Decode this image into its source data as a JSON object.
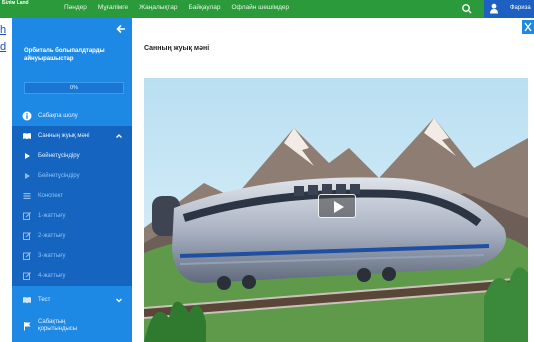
{
  "header": {
    "logo_text": "Білім Land",
    "nav": [
      "Пәндер",
      "Мұғалімге",
      "Жаңалықтар",
      "Байқаулар",
      "Офлайн шешімдер"
    ],
    "user_name": "Фариза",
    "icons": {
      "search": "search-icon",
      "user": "user-icon"
    },
    "colors": {
      "bar": "#2b9a3a",
      "user_block": "#1e5fc2"
    }
  },
  "left_fragment": {
    "line1": "h",
    "line2": "d"
  },
  "sidebar": {
    "course_title": "Орбиталь болыпалдтарды айнуырашыстар",
    "progress_text": "0%",
    "progress": 0,
    "items": [
      {
        "label": "Сабақпа шолу",
        "icon": "info-icon"
      },
      {
        "label": "Санның жуық мәні",
        "icon": "book-icon",
        "expanded": true
      },
      {
        "label": "Бейнетұсіндіру",
        "icon": "play-icon"
      },
      {
        "label": "Бейнетұсіндіру",
        "icon": "play-icon"
      },
      {
        "label": "Конспект",
        "icon": "list-icon"
      },
      {
        "label": "1-жаттығу",
        "icon": "edit-icon"
      },
      {
        "label": "2-жаттығу",
        "icon": "edit-icon"
      },
      {
        "label": "3-жаттығу",
        "icon": "edit-icon"
      },
      {
        "label": "4-жаттығу",
        "icon": "edit-icon"
      },
      {
        "label": "Тест",
        "icon": "book-icon"
      },
      {
        "label": "Сабақтың қорытындысы",
        "icon": "flag-icon"
      }
    ],
    "colors": {
      "bg": "#1e88e5",
      "active": "#1565c0"
    }
  },
  "main": {
    "title": "Санның жуық мәні",
    "video_icon": "play-icon"
  }
}
